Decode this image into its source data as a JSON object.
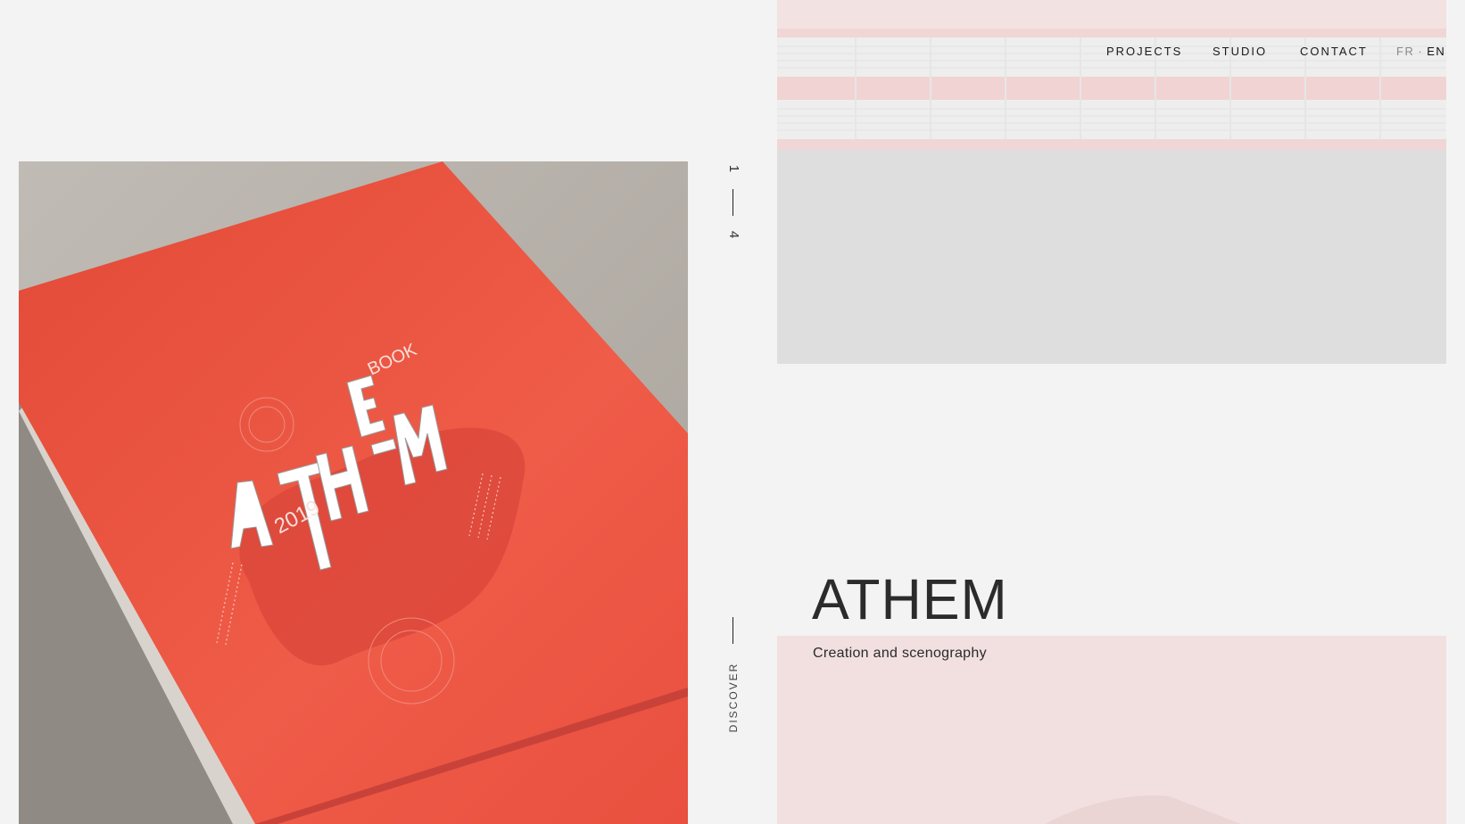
{
  "counter": {
    "current": "1",
    "total": "4"
  },
  "discover_label": "DISCOVER",
  "nav": {
    "projects": "PROJECTS",
    "studio": "STUDIO",
    "contact": "CONTACT"
  },
  "language": {
    "fr": "FR",
    "separator": "·",
    "en": "EN"
  },
  "project": {
    "title": "ATHEM",
    "subtitle": "Creation and scenography"
  },
  "book_cover": {
    "badge": "BOOK",
    "year": "2019",
    "logo": "ATHEM"
  },
  "colors": {
    "background": "#f3f3f3",
    "book_red": "#e8513f",
    "panel_pink": "#f2e0e0"
  },
  "icons": {
    "counter_divider": "vertical-line-icon",
    "discover_divider": "vertical-line-icon"
  }
}
